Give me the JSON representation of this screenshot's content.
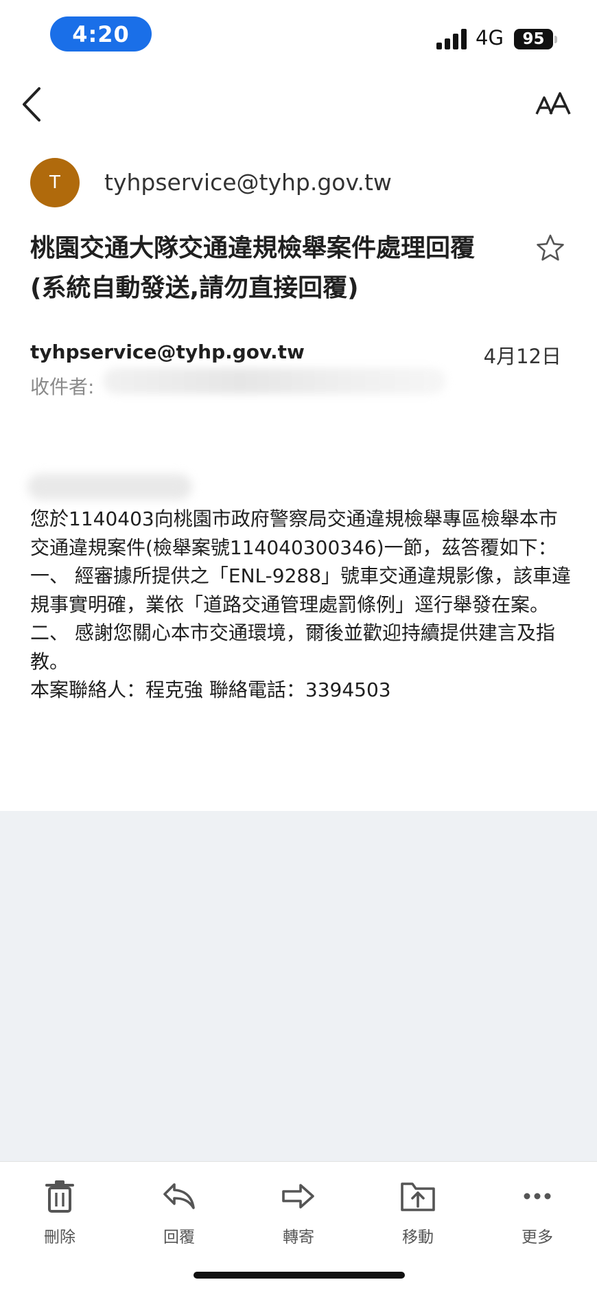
{
  "status_bar": {
    "time": "4:20",
    "network": "4G",
    "battery": "95",
    "colors": {
      "time_pill": "#1a6fe8"
    }
  },
  "toolbar": {
    "back_icon": "chevron-left-icon",
    "text_size_icon": "text-size-icon"
  },
  "sender": {
    "avatar_letter": "T",
    "avatar_color": "#b06a0c",
    "email": "tyhpservice@tyhp.gov.tw"
  },
  "email": {
    "subject": "桃園交通大隊交通違規檢舉案件處理回覆(系統自動發送,請勿直接回覆)",
    "star_icon": "star-outline-icon",
    "from": "tyhpservice@tyhp.gov.tw",
    "date": "4月12日",
    "to_label": "收件者: ",
    "body": [
      "您於1140403向桃園市政府警察局交通違規檢舉專區檢舉本市交通違規案件(檢舉案號114040300346)一節，茲答覆如下：",
      "一、 經審據所提供之「ENL-9288」號車交通違規影像，該車違規事實明確，業依「道路交通管理處罰條例」逕行舉發在案。",
      "二、 感謝您關心本市交通環境，爾後並歡迎持續提供建言及指教。",
      "本案聯絡人：程克強 聯絡電話：3394503"
    ]
  },
  "actions": [
    {
      "label": "刪除",
      "icon": "trash-icon"
    },
    {
      "label": "回覆",
      "icon": "reply-icon"
    },
    {
      "label": "轉寄",
      "icon": "forward-icon"
    },
    {
      "label": "移動",
      "icon": "move-folder-icon"
    },
    {
      "label": "更多",
      "icon": "more-icon"
    }
  ],
  "theme": {
    "grey_area": "#eef1f4",
    "icon_color": "#555555"
  }
}
